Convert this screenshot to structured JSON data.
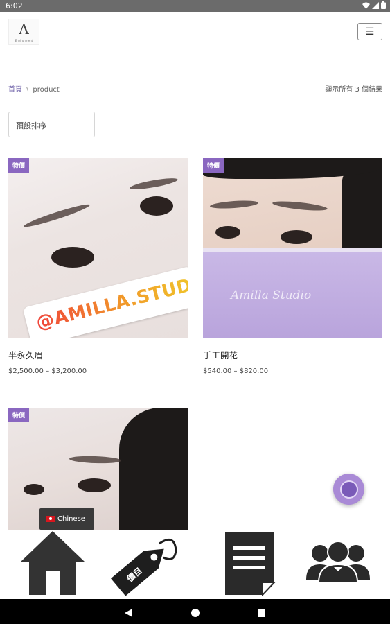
{
  "status_bar": {
    "time": "6:02"
  },
  "header": {
    "logo_mark": "A",
    "logo_sub": "Environment"
  },
  "breadcrumb": {
    "home": "首頁",
    "separator": "\\",
    "current": "product"
  },
  "result_count": "顯示所有 3 個結果",
  "sort": {
    "selected": "預設排序"
  },
  "products": [
    {
      "badge": "特價",
      "name": "半永久眉",
      "price": "$2,500.00 – $3,200.00",
      "overlay_text": "@AMILLA.STUDIO"
    },
    {
      "badge": "特價",
      "name": "手工開花",
      "price": "$540.00 – $820.00",
      "overlay_text": "Amilla Studio"
    },
    {
      "badge": "特價",
      "name": "",
      "price": ""
    }
  ],
  "language": {
    "label": "Chinese"
  },
  "bottom_nav": {
    "items": [
      {
        "icon": "home-icon"
      },
      {
        "icon": "price-tag-icon",
        "tag_text": "價目"
      },
      {
        "icon": "document-icon"
      },
      {
        "icon": "team-icon"
      }
    ]
  },
  "colors": {
    "accent": "#8a67c0",
    "link": "#6c5fa7",
    "fab": "#a98ad6"
  }
}
